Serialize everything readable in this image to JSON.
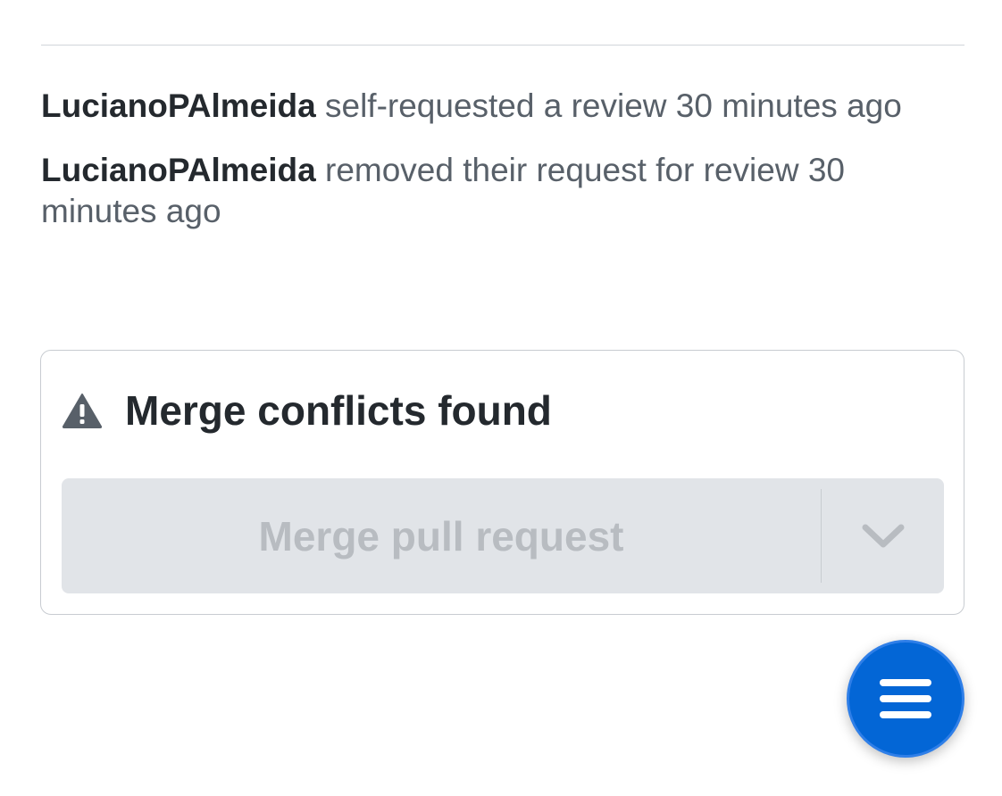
{
  "timeline": {
    "events": [
      {
        "actor": "LucianoPAlmeida",
        "action": "self-requested a review 30 minutes ago"
      },
      {
        "actor": "LucianoPAlmeida",
        "action": "removed their request for review 30 minutes ago"
      }
    ]
  },
  "merge": {
    "title": "Merge conflicts found",
    "status_icon": "alert-triangle-icon",
    "button_label": "Merge pull request",
    "dropdown_icon": "chevron-down-icon"
  },
  "fab": {
    "icon": "menu-icon",
    "color": "#0366d6"
  },
  "colors": {
    "text_primary": "#24292e",
    "text_secondary": "#586069",
    "disabled_bg": "#e1e4e8",
    "disabled_text": "#b8bcc1"
  }
}
